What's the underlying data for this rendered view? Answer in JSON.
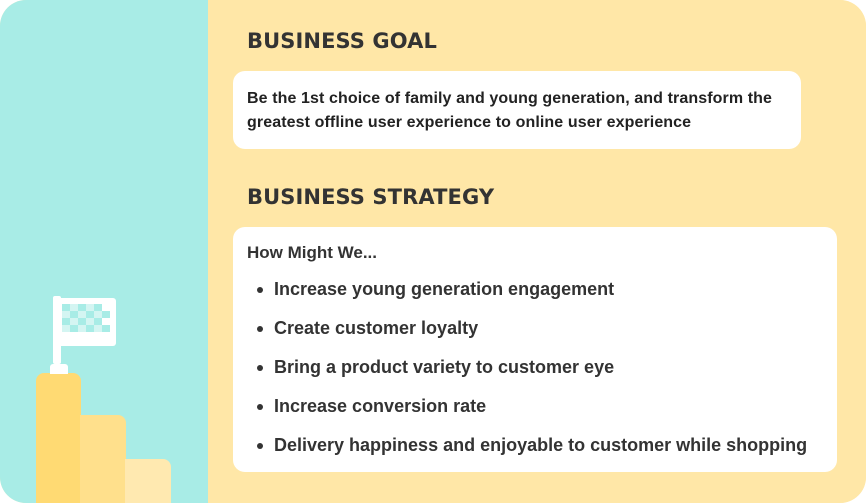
{
  "goal": {
    "heading": "BUSINESS GOAL",
    "text": "Be the 1st choice of family and young generation, and transform the greatest offline user experience to online user experience"
  },
  "strategy": {
    "heading": "BUSINESS STRATEGY",
    "prompt": "How Might We...",
    "items": [
      "Increase young generation engagement",
      "Create customer loyalty",
      "Bring a product variety to customer eye",
      "Increase conversion rate",
      "Delivery happiness and enjoyable to customer while shopping"
    ]
  },
  "illustration": {
    "icons": [
      "checkered-flag-icon",
      "podium-icon"
    ]
  },
  "colors": {
    "left_panel": "#A8ECE6",
    "right_panel": "#FFE7A7",
    "card": "#FFFFFF",
    "text": "#333333",
    "flag_check": "#A8ECE6",
    "podium_first": "#FFDA73",
    "podium_second": "#FFE08C",
    "podium_third": "#FFE9B0"
  }
}
